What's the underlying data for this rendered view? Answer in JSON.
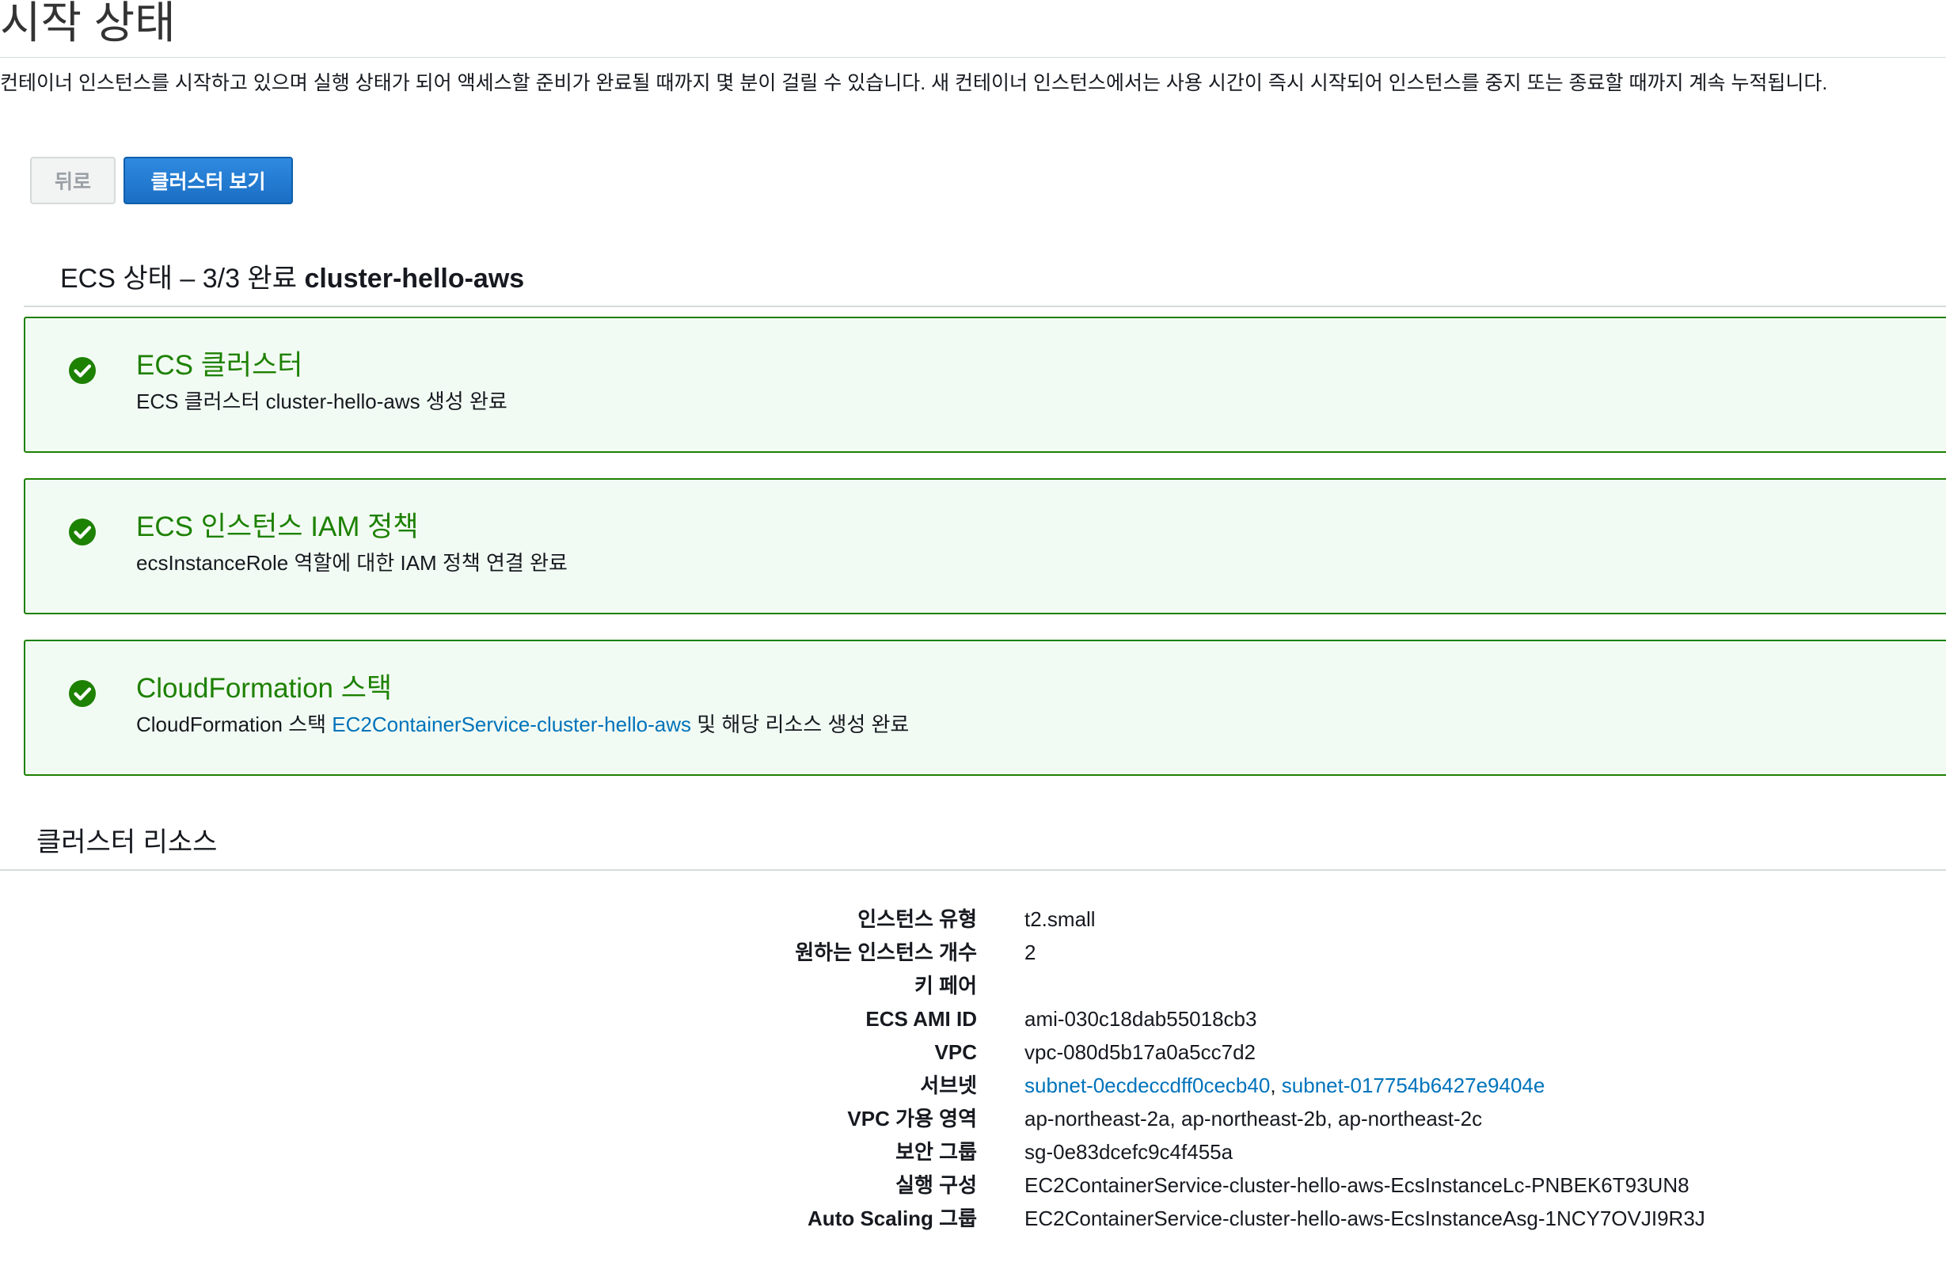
{
  "page": {
    "title": "시작 상태",
    "intro": "컨테이너 인스턴스를 시작하고 있으며 실행 상태가 되어 액세스할 준비가 완료될 때까지 몇 분이 걸릴 수 있습니다. 새 컨테이너 인스턴스에서는 사용 시간이 즉시 시작되어 인스턴스를 중지 또는 종료할 때까지 계속 누적됩니다."
  },
  "buttons": {
    "back": "뒤로",
    "view_cluster": "클러스터 보기"
  },
  "status": {
    "heading_prefix": "ECS 상태 – 3/3 완료",
    "cluster_name": "cluster-hello-aws"
  },
  "cards": [
    {
      "icon": "check-circle-icon",
      "title": "ECS 클러스터",
      "text": "ECS 클러스터 cluster-hello-aws 생성 완료"
    },
    {
      "icon": "check-circle-icon",
      "title": "ECS 인스턴스 IAM 정책",
      "text": "ecsInstanceRole 역할에 대한 IAM 정책 연결 완료"
    },
    {
      "icon": "check-circle-icon",
      "title": "CloudFormation 스택",
      "text_before": "CloudFormation 스택",
      "link": "EC2ContainerService-cluster-hello-aws",
      "text_after": "및 해당 리소스 생성 완료"
    }
  ],
  "resources": {
    "heading": "클러스터 리소스",
    "rows": [
      {
        "key": "인스턴스 유형",
        "value": "t2.small"
      },
      {
        "key": "원하는 인스턴스 개수",
        "value": "2"
      },
      {
        "key": "키 페어",
        "value": ""
      },
      {
        "key": "ECS AMI ID",
        "value": "ami-030c18dab55018cb3"
      },
      {
        "key": "VPC",
        "value": "vpc-080d5b17a0a5cc7d2"
      },
      {
        "key": "서브넷",
        "value_a": "subnet-0ecdeccdff0cecb40",
        "sep": ",",
        "value_b": "subnet-017754b6427e9404e"
      },
      {
        "key": "VPC 가용 영역",
        "value": "ap-northeast-2a, ap-northeast-2b, ap-northeast-2c"
      },
      {
        "key": "보안 그룹",
        "value": "sg-0e83dcefc9c4f455a"
      },
      {
        "key": "실행 구성",
        "value": "EC2ContainerService-cluster-hello-aws-EcsInstanceLc-PNBEK6T93UN8"
      },
      {
        "key": "Auto Scaling 그룹",
        "value": "EC2ContainerService-cluster-hello-aws-EcsInstanceAsg-1NCY7OVJI9R3J"
      }
    ]
  },
  "colors": {
    "success": "#1d8102",
    "link": "#0073bb",
    "primary_button": "#1a6fc4"
  }
}
